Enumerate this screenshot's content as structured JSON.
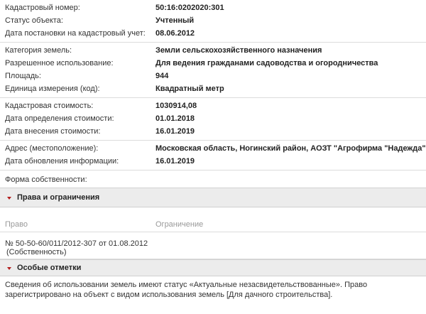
{
  "info": {
    "group1": [
      {
        "label": "Кадастровый номер:",
        "value": "50:16:0202020:301"
      },
      {
        "label": "Статус объекта:",
        "value": "Учтенный"
      },
      {
        "label": "Дата постановки на кадастровый учет:",
        "value": "08.06.2012"
      }
    ],
    "group2": [
      {
        "label": "Категория земель:",
        "value": "Земли сельскохозяйственного назначения"
      },
      {
        "label": "Разрешенное использование:",
        "value": "Для ведения гражданами садоводства и огородничества"
      },
      {
        "label": "Площадь:",
        "value": "944"
      },
      {
        "label": "Единица измерения (код):",
        "value": "Квадратный метр"
      }
    ],
    "group3": [
      {
        "label": "Кадастровая стоимость:",
        "value": "1030914,08"
      },
      {
        "label": "Дата определения стоимости:",
        "value": "01.01.2018"
      },
      {
        "label": "Дата внесения стоимости:",
        "value": "16.01.2019"
      }
    ],
    "group4": [
      {
        "label": "Адрес (местоположение):",
        "value": "Московская область, Ногинский район, АОЗТ \"Агрофирма \"Надежда\""
      },
      {
        "label": "Дата обновления информации:",
        "value": "16.01.2019"
      }
    ],
    "ownership_label": "Форма собственности:"
  },
  "rights": {
    "header": "Права и ограничения",
    "col_right": "Право",
    "col_restriction": "Ограничение",
    "entry_line1": "№ 50-50-60/011/2012-307  от 01.08.2012",
    "entry_line2": "(Собственность)"
  },
  "notes": {
    "header": "Особые отметки",
    "text": "Сведения об использовании земель имеют статус «Актуальные незасвидетельствованные». Право зарегистрировано на объект с видом использования земель [Для дачного строительства]."
  },
  "colors": {
    "accent_triangle": "#b41e1e",
    "header_bg": "#ececec"
  }
}
